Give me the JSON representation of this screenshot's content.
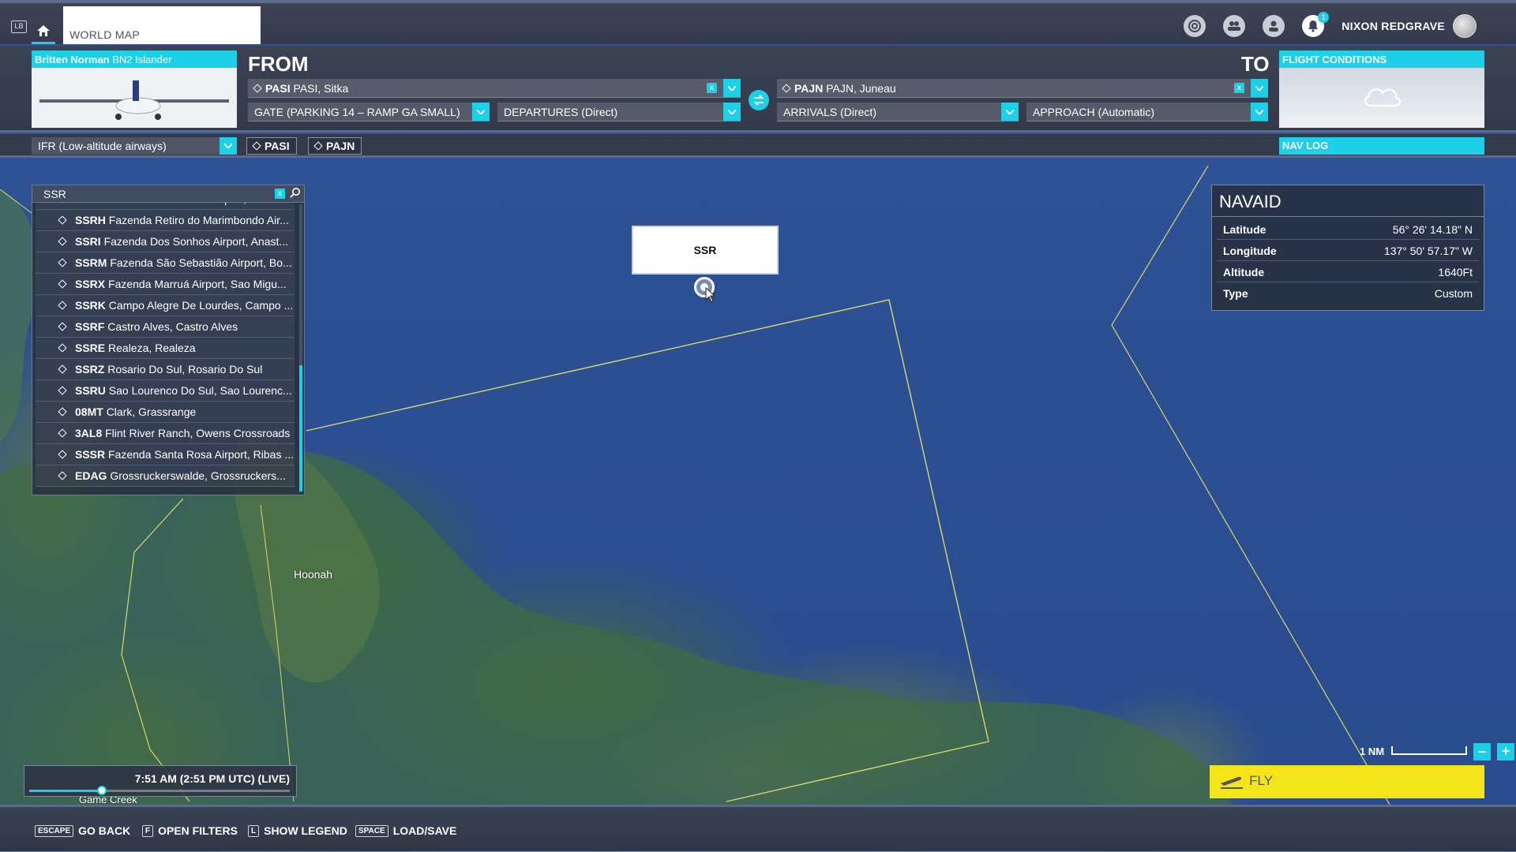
{
  "header": {
    "lb_key": "LB",
    "tab_title": "WORLD MAP",
    "notification_count": "1",
    "username": "NIXON REDGRAVE"
  },
  "aircraft": {
    "maker": "Britten Norman",
    "model": "BN2 Islander"
  },
  "flight_conditions": {
    "title": "FLIGHT CONDITIONS"
  },
  "from": {
    "label": "FROM",
    "airport_code": "PASI",
    "airport_name": "PASI, Sitka",
    "gate": "GATE (PARKING 14 – RAMP GA SMALL)",
    "departure": "DEPARTURES (Direct)"
  },
  "to": {
    "label": "TO",
    "airport_code": "PAJN",
    "airport_name": "PAJN, Juneau",
    "arrival": "ARRIVALS (Direct)",
    "approach": "APPROACH (Automatic)"
  },
  "route": {
    "type": "IFR (Low-altitude airways)",
    "waypoints": [
      "PASI",
      "PAJN"
    ],
    "navlog_label": "NAV LOG"
  },
  "search": {
    "query": "SSR",
    "clear": "x",
    "results": [
      {
        "code": "SSRG",
        "name": "Fazenda Santa Ines Airport, Rio Bri..."
      },
      {
        "code": "SSRH",
        "name": "Fazenda Retiro do Marimbondo Air..."
      },
      {
        "code": "SSRI",
        "name": "Fazenda Dos Sonhos Airport, Anast..."
      },
      {
        "code": "SSRM",
        "name": "Fazenda São Sebastião Airport, Bo..."
      },
      {
        "code": "SSRX",
        "name": "Fazenda Marruá Airport, Sao Migu..."
      },
      {
        "code": "SSRK",
        "name": "Campo Alegre De Lourdes, Campo ..."
      },
      {
        "code": "SSRF",
        "name": "Castro Alves, Castro Alves"
      },
      {
        "code": "SSRE",
        "name": "Realeza, Realeza"
      },
      {
        "code": "SSRZ",
        "name": "Rosario Do Sul, Rosario Do Sul"
      },
      {
        "code": "SSRU",
        "name": "Sao Lourenco Do Sul, Sao Lourenc..."
      },
      {
        "code": "08MT",
        "name": "Clark, Grassrange"
      },
      {
        "code": "3AL8",
        "name": "Flint River Ranch, Owens Crossroads"
      },
      {
        "code": "SSSR",
        "name": "Fazenda Santa Rosa Airport, Ribas ..."
      },
      {
        "code": "EDAG",
        "name": "Grossruckerswalde, Grossruckers..."
      }
    ]
  },
  "map": {
    "callout_label": "SSR",
    "towns": [
      "Hoonah",
      "Game Creek"
    ]
  },
  "navaid": {
    "title": "NAVAID",
    "rows": [
      {
        "key": "Latitude",
        "value": "56° 26' 14.18\" N"
      },
      {
        "key": "Longitude",
        "value": "137° 50' 57.17\" W"
      },
      {
        "key": "Altitude",
        "value": "1640Ft"
      },
      {
        "key": "Type",
        "value": "Custom"
      }
    ]
  },
  "time": {
    "label": "7:51 AM (2:51 PM UTC) (LIVE)",
    "slider_fraction": 0.28
  },
  "scale": {
    "label": "1 NM",
    "zoom_out": "–",
    "zoom_in": "+"
  },
  "fly": {
    "label": "FLY"
  },
  "footer": {
    "hints": [
      {
        "key": "ESCAPE",
        "label": "GO BACK"
      },
      {
        "key": "F",
        "label": "OPEN FILTERS"
      },
      {
        "key": "L",
        "label": "SHOW LEGEND"
      },
      {
        "key": "SPACE",
        "label": "LOAD/SAVE"
      }
    ]
  },
  "colors": {
    "accent": "#1ecfe8",
    "fly": "#f4e51b",
    "route_line": "#d9d86a"
  }
}
